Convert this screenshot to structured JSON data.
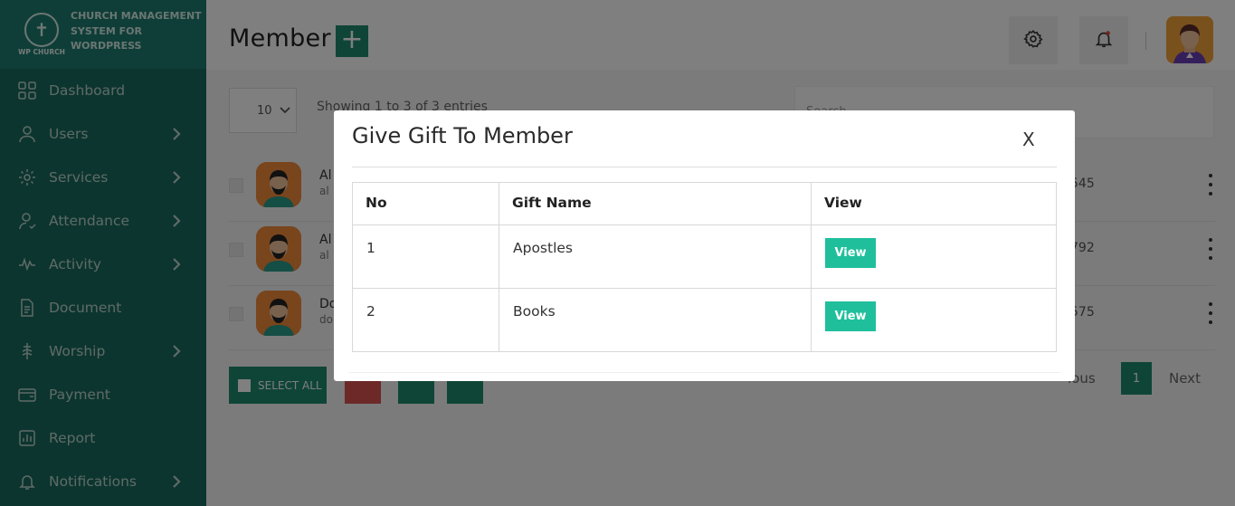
{
  "brand": {
    "logo_sub": "WP CHURCH",
    "line1": "CHURCH MANAGEMENT",
    "line2": "SYSTEM FOR",
    "line3": "WORDPRESS"
  },
  "sidebar": {
    "items": [
      {
        "label": "Dashboard",
        "icon": "dashboard-icon",
        "has_arrow": false
      },
      {
        "label": "Users",
        "icon": "user-icon",
        "has_arrow": true
      },
      {
        "label": "Services",
        "icon": "services-icon",
        "has_arrow": true
      },
      {
        "label": "Attendance",
        "icon": "attendance-icon",
        "has_arrow": true
      },
      {
        "label": "Activity",
        "icon": "activity-icon",
        "has_arrow": true
      },
      {
        "label": "Document",
        "icon": "document-icon",
        "has_arrow": false
      },
      {
        "label": "Worship",
        "icon": "worship-icon",
        "has_arrow": true
      },
      {
        "label": "Payment",
        "icon": "payment-icon",
        "has_arrow": false
      },
      {
        "label": "Report",
        "icon": "report-icon",
        "has_arrow": false
      },
      {
        "label": "Notifications",
        "icon": "bell-icon",
        "has_arrow": true
      }
    ]
  },
  "header": {
    "title": "Member",
    "add_label": "+"
  },
  "list": {
    "page_length": "10",
    "info": "Showing 1 to 3 of 3 entries",
    "search_placeholder": "Search...",
    "rows": [
      {
        "name": "Al",
        "email": "al",
        "phone": "545"
      },
      {
        "name": "Al",
        "email": "al",
        "phone": "792"
      },
      {
        "name": "Do",
        "email": "do",
        "phone": "575"
      }
    ],
    "select_all_label": "SELECT ALL",
    "prev_label": "ious",
    "page_number": "1",
    "next_label": "Next"
  },
  "modal": {
    "title": "Give Gift To Member",
    "close_label": "X",
    "columns": [
      "No",
      "Gift Name",
      "View"
    ],
    "rows": [
      {
        "no": "1",
        "gift_name": "Apostles",
        "view_label": "View"
      },
      {
        "no": "2",
        "gift_name": "Books",
        "view_label": "View"
      }
    ]
  },
  "colors": {
    "sidebar": "#1a6b5f",
    "brand_bg": "#1e7d70",
    "accent": "#1f8a6e",
    "view_button": "#1fbf9c",
    "delete": "#d9534f"
  }
}
